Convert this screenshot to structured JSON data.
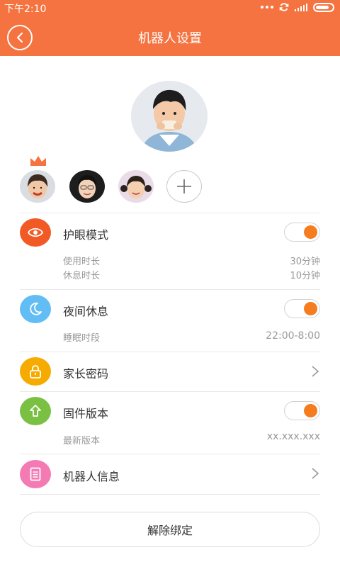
{
  "status_bar": {
    "time": "下午2:10"
  },
  "header": {
    "title": "机器人设置"
  },
  "colors": {
    "accent": "#f57340",
    "eye_icon_bg": "#f15a24",
    "night_icon_bg": "#62bdf5",
    "password_icon_bg": "#f6ab00",
    "firmware_icon_bg": "#7ac143",
    "info_icon_bg": "#f47ab3",
    "toggle_knob": "#f57c1f"
  },
  "members": {
    "main": "child-boy-avatar",
    "list": [
      {
        "name": "child-girl-avatar-1",
        "is_admin": true
      },
      {
        "name": "woman-avatar",
        "is_admin": false
      },
      {
        "name": "child-girl-avatar-2",
        "is_admin": false
      }
    ]
  },
  "settings": {
    "eye_mode": {
      "label": "护眼模式",
      "enabled": true,
      "use_label": "使用时长",
      "use_value": "30分钟",
      "rest_label": "休息时长",
      "rest_value": "10分钟"
    },
    "night_rest": {
      "label": "夜间休息",
      "enabled": true,
      "sleep_label": "睡眠时段",
      "sleep_value": "22:00-8:00"
    },
    "parent_password": {
      "label": "家长密码"
    },
    "firmware": {
      "label": "固件版本",
      "enabled": true,
      "latest_label": "最新版本",
      "latest_value": "xx.xxx.xxx"
    },
    "robot_info": {
      "label": "机器人信息"
    }
  },
  "unbind_button": {
    "label": "解除绑定"
  }
}
